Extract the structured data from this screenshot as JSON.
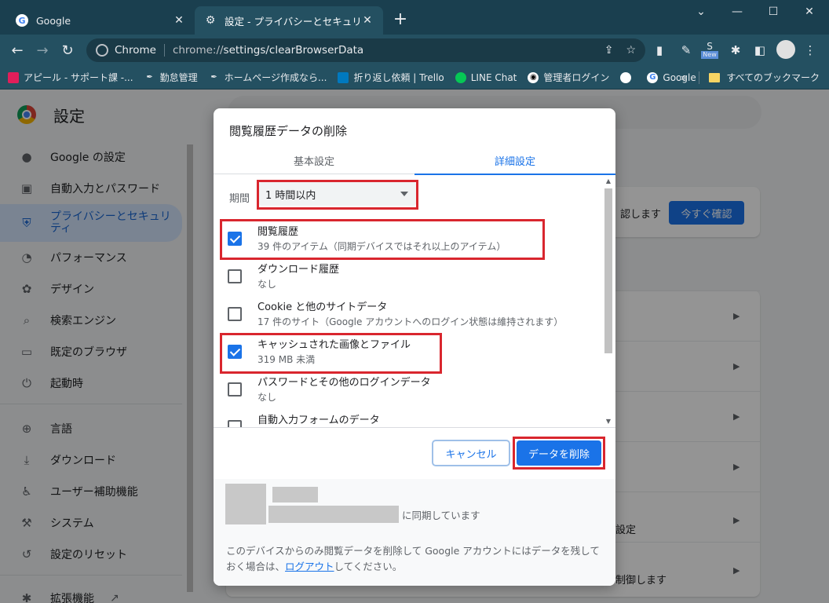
{
  "tabs": [
    {
      "title": "Google",
      "active": false
    },
    {
      "title": "設定 - プライバシーとセキュリティ",
      "active": true
    }
  ],
  "toolbar": {
    "site_label": "Chrome",
    "url_prefix": "chrome://",
    "url_path": "settings/clearBrowserData"
  },
  "bookmarks": [
    "アピール - サポート課 -...",
    "勤怠管理",
    "ホームページ作成なら...",
    "折り返し依頼 | Trello",
    "LINE Chat",
    "管理者ログイン",
    "",
    "Google"
  ],
  "bookmarks_overflow": "»",
  "bookmarks_all": "すべてのブックマーク",
  "extension_badge": "New",
  "settings": {
    "title": "設定",
    "sidebar": [
      {
        "label": "Google の設定",
        "icon": "person-icon"
      },
      {
        "label": "自動入力とパスワード",
        "icon": "clipboard-icon"
      },
      {
        "label": "プライバシーとセキュリティ",
        "icon": "shield-icon",
        "selected": true
      },
      {
        "label": "パフォーマンス",
        "icon": "speedometer-icon"
      },
      {
        "label": "デザイン",
        "icon": "palette-icon"
      },
      {
        "label": "検索エンジン",
        "icon": "search-icon"
      },
      {
        "label": "既定のブラウザ",
        "icon": "browser-icon"
      },
      {
        "label": "起動時",
        "icon": "power-icon"
      },
      {
        "label": "言語",
        "icon": "globe-icon"
      },
      {
        "label": "ダウンロード",
        "icon": "download-icon"
      },
      {
        "label": "ユーザー補助機能",
        "icon": "accessibility-icon"
      },
      {
        "label": "システム",
        "icon": "wrench-icon"
      },
      {
        "label": "設定のリセット",
        "icon": "reset-icon"
      },
      {
        "label": "拡張機能",
        "icon": "extension-icon"
      }
    ],
    "safety_check_text": "認します",
    "safety_check_button": "今すぐ確認",
    "row_text_1": "設定",
    "row_text_2": "制御します"
  },
  "dialog": {
    "title": "閲覧履歴データの削除",
    "tab_basic": "基本設定",
    "tab_advanced": "詳細設定",
    "range_label": "期間",
    "range_value": "1 時間以内",
    "items": [
      {
        "title": "閲覧履歴",
        "subtitle": "39 件のアイテム（同期デバイスではそれ以上のアイテム）",
        "checked": true
      },
      {
        "title": "ダウンロード履歴",
        "subtitle": "なし",
        "checked": false
      },
      {
        "title": "Cookie と他のサイトデータ",
        "subtitle": "17 件のサイト（Google アカウントへのログイン状態は維持されます）",
        "checked": false
      },
      {
        "title": "キャッシュされた画像とファイル",
        "subtitle": "319 MB 未満",
        "checked": true
      },
      {
        "title": "パスワードとその他のログインデータ",
        "subtitle": "なし",
        "checked": false
      },
      {
        "title": "自動入力フォームのデータ",
        "subtitle": "",
        "checked": false
      }
    ],
    "cancel_label": "キャンセル",
    "delete_label": "データを削除",
    "sync_text": "に同期しています",
    "note_before": "このデバイスからのみ閲覧データを削除して Google アカウントにはデータを残しておく場合は、",
    "note_link": "ログアウト",
    "note_after": "してください。"
  },
  "highlight_color": "#d9262e",
  "accent_color": "#1a73e8"
}
